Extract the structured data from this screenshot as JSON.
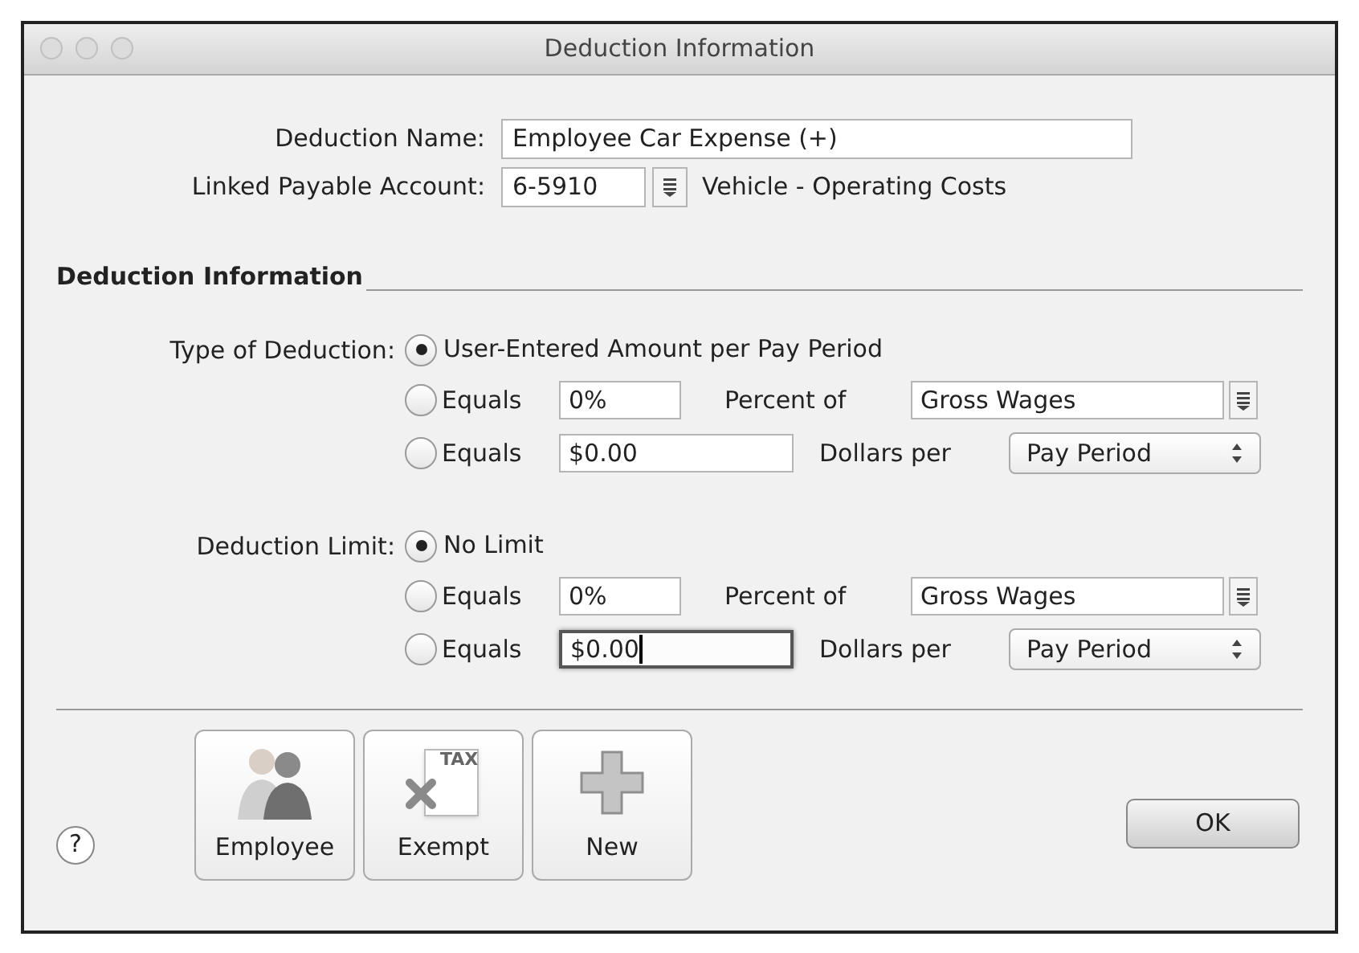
{
  "window": {
    "title": "Deduction Information"
  },
  "deduction_name": {
    "label": "Deduction Name:",
    "value": "Employee Car Expense (+)"
  },
  "linked_account": {
    "label": "Linked Payable Account:",
    "value": "6-5910",
    "name": "Vehicle - Operating Costs"
  },
  "section_title": "Deduction Information",
  "groups": [
    {
      "label": "Type of Deduction:",
      "options": [
        {
          "kind": "text",
          "label": "User-Entered Amount per Pay Period",
          "selected": true
        },
        {
          "kind": "percent",
          "label": "Equals",
          "value": "0%",
          "connector": "Percent of",
          "choice": "Gross Wages",
          "selected": false,
          "focused": false
        },
        {
          "kind": "dollars",
          "label": "Equals",
          "value": "$0.00",
          "connector": "Dollars per",
          "choice": "Pay Period",
          "selected": false,
          "focused": false
        }
      ]
    },
    {
      "label": "Deduction Limit:",
      "options": [
        {
          "kind": "text",
          "label": "No Limit",
          "selected": true
        },
        {
          "kind": "percent",
          "label": "Equals",
          "value": "0%",
          "connector": "Percent of",
          "choice": "Gross Wages",
          "selected": false,
          "focused": false
        },
        {
          "kind": "dollars",
          "label": "Equals",
          "value": "$0.00",
          "connector": "Dollars per",
          "choice": "Pay Period",
          "selected": false,
          "focused": true
        }
      ]
    }
  ],
  "help": "?",
  "tool_buttons": [
    {
      "kind": "employee",
      "label": "Employee"
    },
    {
      "kind": "exempt",
      "label": "Exempt",
      "icon_text": "TAX"
    },
    {
      "kind": "new",
      "label": "New"
    }
  ],
  "ok_button": "OK"
}
